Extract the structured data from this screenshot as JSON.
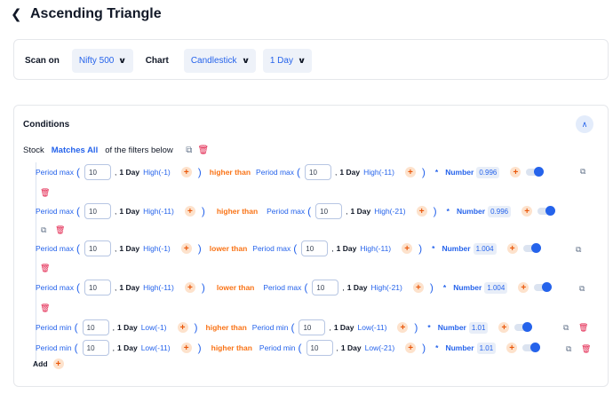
{
  "header": {
    "back_icon": "chevron-left-icon",
    "title": "Ascending Triangle"
  },
  "scan": {
    "scan_on_label": "Scan on",
    "universe": "Nifty 500",
    "chart_label": "Chart",
    "chart_type": "Candlestick",
    "timeframe": "1 Day"
  },
  "conditions": {
    "heading": "Conditions",
    "stock_label": "Stock",
    "matches": "Matches All",
    "suffix": "of the filters below",
    "add_label": "Add"
  },
  "filters": [
    {
      "left_fn": "Period max",
      "left_val": "10",
      "left_tf": "1 Day",
      "left_field": "High(-1)",
      "op": "higher than",
      "right_fn": "Period max",
      "right_val": "10",
      "right_tf": "1 Day",
      "right_field": "High(-11)",
      "mul": "*",
      "num_label": "Number",
      "num": "0.996"
    },
    {
      "left_fn": "Period max",
      "left_val": "10",
      "left_tf": "1 Day",
      "left_field": "High(-11)",
      "op": "higher than",
      "right_fn": "Period max",
      "right_val": "10",
      "right_tf": "1 Day",
      "right_field": "High(-21)",
      "mul": "*",
      "num_label": "Number",
      "num": "0.996"
    },
    {
      "left_fn": "Period max",
      "left_val": "10",
      "left_tf": "1 Day",
      "left_field": "High(-1)",
      "op": "lower than",
      "right_fn": "Period max",
      "right_val": "10",
      "right_tf": "1 Day",
      "right_field": "High(-11)",
      "mul": "*",
      "num_label": "Number",
      "num": "1.004"
    },
    {
      "left_fn": "Period max",
      "left_val": "10",
      "left_tf": "1 Day",
      "left_field": "High(-11)",
      "op": "lower than",
      "right_fn": "Period max",
      "right_val": "10",
      "right_tf": "1 Day",
      "right_field": "High(-21)",
      "mul": "*",
      "num_label": "Number",
      "num": "1.004"
    },
    {
      "left_fn": "Period min",
      "left_val": "10",
      "left_tf": "1 Day",
      "left_field": "Low(-1)",
      "op": "higher than",
      "right_fn": "Period min",
      "right_val": "10",
      "right_tf": "1 Day",
      "right_field": "Low(-11)",
      "mul": "*",
      "num_label": "Number",
      "num": "1.01"
    },
    {
      "left_fn": "Period min",
      "left_val": "10",
      "left_tf": "1 Day",
      "left_field": "Low(-11)",
      "op": "higher than",
      "right_fn": "Period min",
      "right_val": "10",
      "right_tf": "1 Day",
      "right_field": "Low(-21)",
      "mul": "*",
      "num_label": "Number",
      "num": "1.01"
    }
  ],
  "colors": {
    "accent": "#2563eb",
    "operator": "#f97316",
    "delete": "#e11d48"
  }
}
